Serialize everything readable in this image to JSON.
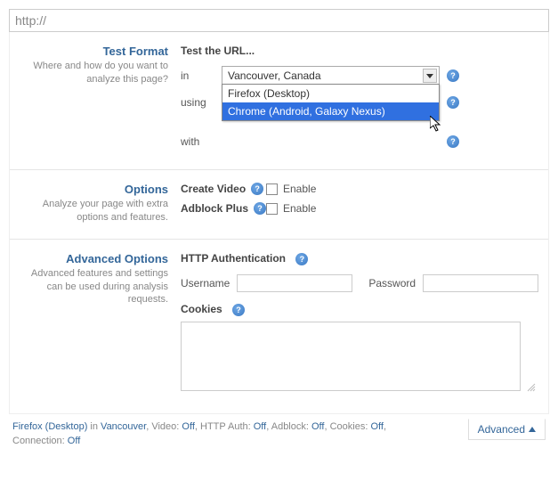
{
  "url_input_value": "http://",
  "test_format": {
    "title": "Test Format",
    "desc": "Where and how do you want to analyze this page?",
    "heading": "Test the URL...",
    "in_label": "in",
    "using_label": "using",
    "with_label": "with",
    "location_selected": "Vancouver, Canada",
    "browser_selected": "Firefox (Desktop)",
    "browser_options": [
      "Firefox (Desktop)",
      "Chrome (Android, Galaxy Nexus)"
    ]
  },
  "options": {
    "title": "Options",
    "desc": "Analyze your page with extra options and features.",
    "create_video_label": "Create Video",
    "adblock_label": "Adblock Plus",
    "enable_label": "Enable"
  },
  "advanced": {
    "title": "Advanced Options",
    "desc": "Advanced features and settings can be used during analysis requests.",
    "http_auth_label": "HTTP Authentication",
    "username_label": "Username",
    "password_label": "Password",
    "cookies_label": "Cookies"
  },
  "footer": {
    "browser": "Firefox (Desktop)",
    "in": "in",
    "location": "Vancouver",
    "video": "Video:",
    "video_val": "Off",
    "httpauth": "HTTP Auth:",
    "httpauth_val": "Off",
    "adblock": "Adblock:",
    "adblock_val": "Off",
    "cookies": "Cookies:",
    "cookies_val": "Off",
    "connection": "Connection:",
    "connection_val": "Off",
    "advanced_label": "Advanced"
  }
}
